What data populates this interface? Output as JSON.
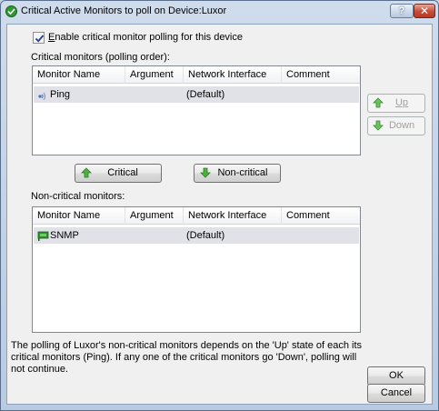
{
  "window": {
    "title": "Critical Active Monitors to poll on Device:Luxor",
    "help_label": "?",
    "close_label": "✕"
  },
  "enable_checkbox": {
    "label": "Enable critical monitor polling for this device",
    "checked": true
  },
  "critical_section": {
    "label": "Critical monitors (polling order):",
    "columns": [
      "Monitor Name",
      "Argument",
      "Network Interface",
      "Comment"
    ],
    "rows": [
      {
        "icon": "ping-icon",
        "name": "Ping",
        "argument": "",
        "interface": "(Default)",
        "comment": ""
      }
    ]
  },
  "order_buttons": {
    "up_label": "Up",
    "down_label": "Down",
    "up_icon": "arrow-up-icon",
    "down_icon": "arrow-down-icon"
  },
  "move_buttons": {
    "critical_label": "Critical",
    "noncritical_label": "Non-critical"
  },
  "noncritical_section": {
    "label": "Non-critical monitors:",
    "columns": [
      "Monitor Name",
      "Argument",
      "Network Interface",
      "Comment"
    ],
    "rows": [
      {
        "icon": "snmp-icon",
        "name": "SNMP",
        "argument": "",
        "interface": "(Default)",
        "comment": ""
      }
    ]
  },
  "note": "The polling of Luxor's non-critical monitors depends on the 'Up' state of each its critical monitors (Ping). If any one of the critical monitors go 'Down', polling will not continue.",
  "dialog_buttons": {
    "ok_label": "OK",
    "cancel_label": "Cancel"
  },
  "colors": {
    "green_arrow": "#3aa12d",
    "selected_row": "#e1e2e8"
  }
}
